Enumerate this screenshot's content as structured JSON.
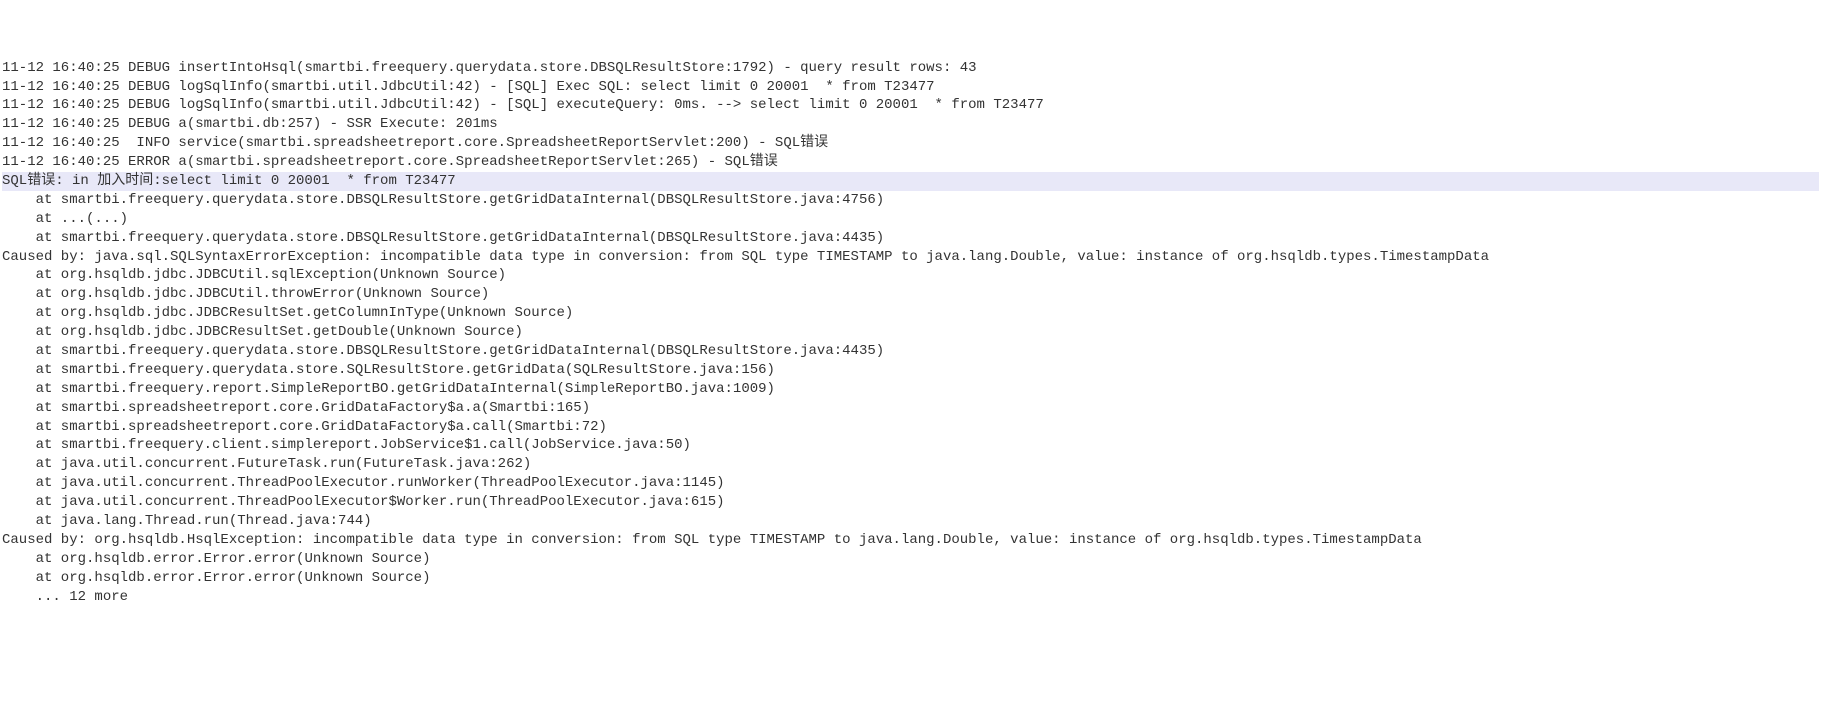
{
  "lines": [
    {
      "text": "11-12 16:40:25 DEBUG insertIntoHsql(smartbi.freequery.querydata.store.DBSQLResultStore:1792) - query result rows: 43",
      "highlight": false
    },
    {
      "text": "11-12 16:40:25 DEBUG logSqlInfo(smartbi.util.JdbcUtil:42) - [SQL] Exec SQL: select limit 0 20001  * from T23477",
      "highlight": false
    },
    {
      "text": "11-12 16:40:25 DEBUG logSqlInfo(smartbi.util.JdbcUtil:42) - [SQL] executeQuery: 0ms. --> select limit 0 20001  * from T23477",
      "highlight": false
    },
    {
      "text": "11-12 16:40:25 DEBUG a(smartbi.db:257) - SSR Execute: 201ms",
      "highlight": false
    },
    {
      "text": "11-12 16:40:25  INFO service(smartbi.spreadsheetreport.core.SpreadsheetReportServlet:200) - SQL错误",
      "highlight": false
    },
    {
      "text": "11-12 16:40:25 ERROR a(smartbi.spreadsheetreport.core.SpreadsheetReportServlet:265) - SQL错误",
      "highlight": false
    },
    {
      "text": "SQL错误: in 加入时间:select limit 0 20001  * from T23477",
      "highlight": true
    },
    {
      "text": "    at smartbi.freequery.querydata.store.DBSQLResultStore.getGridDataInternal(DBSQLResultStore.java:4756)",
      "highlight": false
    },
    {
      "text": "    at ...(...)",
      "highlight": false
    },
    {
      "text": "    at smartbi.freequery.querydata.store.DBSQLResultStore.getGridDataInternal(DBSQLResultStore.java:4435)",
      "highlight": false
    },
    {
      "text": "Caused by: java.sql.SQLSyntaxErrorException: incompatible data type in conversion: from SQL type TIMESTAMP to java.lang.Double, value: instance of org.hsqldb.types.TimestampData",
      "highlight": false
    },
    {
      "text": "    at org.hsqldb.jdbc.JDBCUtil.sqlException(Unknown Source)",
      "highlight": false
    },
    {
      "text": "    at org.hsqldb.jdbc.JDBCUtil.throwError(Unknown Source)",
      "highlight": false
    },
    {
      "text": "    at org.hsqldb.jdbc.JDBCResultSet.getColumnInType(Unknown Source)",
      "highlight": false
    },
    {
      "text": "    at org.hsqldb.jdbc.JDBCResultSet.getDouble(Unknown Source)",
      "highlight": false
    },
    {
      "text": "    at smartbi.freequery.querydata.store.DBSQLResultStore.getGridDataInternal(DBSQLResultStore.java:4435)",
      "highlight": false
    },
    {
      "text": "    at smartbi.freequery.querydata.store.SQLResultStore.getGridData(SQLResultStore.java:156)",
      "highlight": false
    },
    {
      "text": "    at smartbi.freequery.report.SimpleReportBO.getGridDataInternal(SimpleReportBO.java:1009)",
      "highlight": false
    },
    {
      "text": "    at smartbi.spreadsheetreport.core.GridDataFactory$a.a(Smartbi:165)",
      "highlight": false
    },
    {
      "text": "    at smartbi.spreadsheetreport.core.GridDataFactory$a.call(Smartbi:72)",
      "highlight": false
    },
    {
      "text": "    at smartbi.freequery.client.simplereport.JobService$1.call(JobService.java:50)",
      "highlight": false
    },
    {
      "text": "    at java.util.concurrent.FutureTask.run(FutureTask.java:262)",
      "highlight": false
    },
    {
      "text": "    at java.util.concurrent.ThreadPoolExecutor.runWorker(ThreadPoolExecutor.java:1145)",
      "highlight": false
    },
    {
      "text": "    at java.util.concurrent.ThreadPoolExecutor$Worker.run(ThreadPoolExecutor.java:615)",
      "highlight": false
    },
    {
      "text": "    at java.lang.Thread.run(Thread.java:744)",
      "highlight": false
    },
    {
      "text": "Caused by: org.hsqldb.HsqlException: incompatible data type in conversion: from SQL type TIMESTAMP to java.lang.Double, value: instance of org.hsqldb.types.TimestampData",
      "highlight": false
    },
    {
      "text": "    at org.hsqldb.error.Error.error(Unknown Source)",
      "highlight": false
    },
    {
      "text": "    at org.hsqldb.error.Error.error(Unknown Source)",
      "highlight": false
    },
    {
      "text": "    ... 12 more",
      "highlight": false
    }
  ]
}
